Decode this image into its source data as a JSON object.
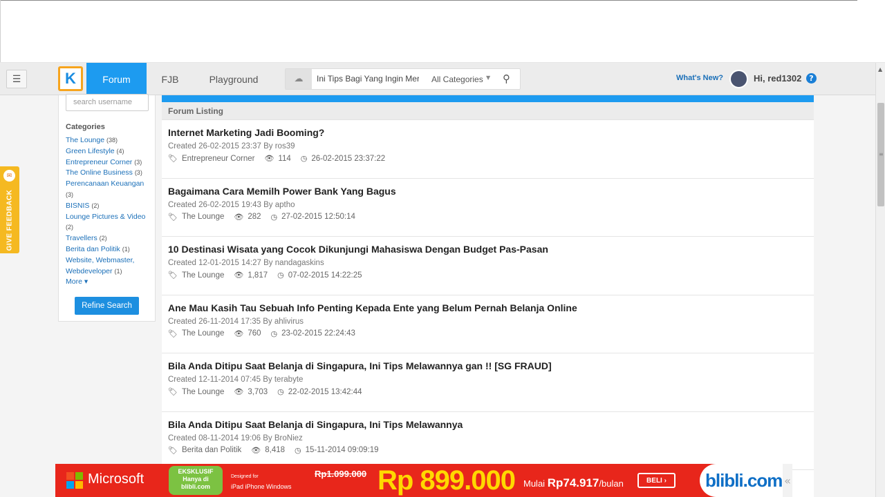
{
  "nav": {
    "menu_icon": "hamburger-icon",
    "logo_letter": "K",
    "tabs": [
      "Forum",
      "FJB",
      "Playground"
    ],
    "search_query": "Ini Tips Bagi Yang Ingin Mer",
    "search_category": "All Categories",
    "whats_new": "What's New?",
    "greeting": "Hi, red1302",
    "help": "?"
  },
  "sidebar": {
    "username_placeholder": "search username",
    "categories_title": "Categories",
    "categories": [
      {
        "name": "The Lounge",
        "count": "(38)"
      },
      {
        "name": "Green Lifestyle",
        "count": "(4)"
      },
      {
        "name": "Entrepreneur Corner",
        "count": "(3)"
      },
      {
        "name": "The Online Business",
        "count": "(3)"
      },
      {
        "name": "Perencanaan Keuangan",
        "count": "(3)"
      },
      {
        "name": "BISNIS",
        "count": "(2)"
      },
      {
        "name": "Lounge Pictures & Video",
        "count": "(2)"
      },
      {
        "name": "Travellers",
        "count": "(2)"
      },
      {
        "name": "Berita dan Politik",
        "count": "(1)"
      },
      {
        "name": "Website, Webmaster, Webdeveloper",
        "count": "(1)"
      }
    ],
    "more": "More",
    "refine_button": "Refine Search"
  },
  "feedback": {
    "label": "GIVE FEEDBACK"
  },
  "listing": {
    "header": "Forum Listing",
    "threads": [
      {
        "title": "Internet Marketing Jadi Booming?",
        "created": "Created 26-02-2015 23:37 By ros39",
        "category": "Entrepreneur Corner",
        "views": "114",
        "last": "26-02-2015 23:37:22"
      },
      {
        "title": "Bagaimana Cara Memilh Power Bank Yang Bagus",
        "created": "Created 26-02-2015 19:43 By aptho",
        "category": "The Lounge",
        "views": "282",
        "last": "27-02-2015 12:50:14"
      },
      {
        "title": "10 Destinasi Wisata yang Cocok Dikunjungi Mahasiswa Dengan Budget Pas-Pasan",
        "created": "Created 12-01-2015 14:27 By nandagaskins",
        "category": "The Lounge",
        "views": "1,817",
        "last": "07-02-2015 14:22:25"
      },
      {
        "title": "Ane Mau Kasih Tau Sebuah Info Penting Kepada Ente yang Belum Pernah Belanja Online",
        "created": "Created 26-11-2014 17:35 By ahlivirus",
        "category": "The Lounge",
        "views": "760",
        "last": "23-02-2015 22:24:43"
      },
      {
        "title": "Bila Anda Ditipu Saat Belanja di Singapura, Ini Tips Melawannya gan !! [SG FRAUD]",
        "created": "Created 12-11-2014 07:45 By terabyte",
        "category": "The Lounge",
        "views": "3,703",
        "last": "22-02-2015 13:42:44"
      },
      {
        "title": "Bila Anda Ditipu Saat Belanja di Singapura, Ini Tips Melawannya",
        "created": "Created 08-11-2014 19:06 By BroNiez",
        "category": "Berita dan Politik",
        "views": "8,418",
        "last": "15-11-2014 09:09:19"
      }
    ]
  },
  "ad": {
    "brand": "Microsoft",
    "exclusive_1": "EKSKLUSIF",
    "exclusive_2": "Hanya di",
    "exclusive_3": "blibli.com",
    "designed_for": "Designed for",
    "platforms": "iPad  iPhone   Windows",
    "old_price": "Rp1.099.000",
    "new_price": "Rp 899.000",
    "mulai_prefix": "Mulai",
    "mulai_amount": "Rp74.917",
    "mulai_suffix": "/bulan",
    "beli": "BELI ›",
    "store": "blibli.com",
    "side": "«"
  }
}
